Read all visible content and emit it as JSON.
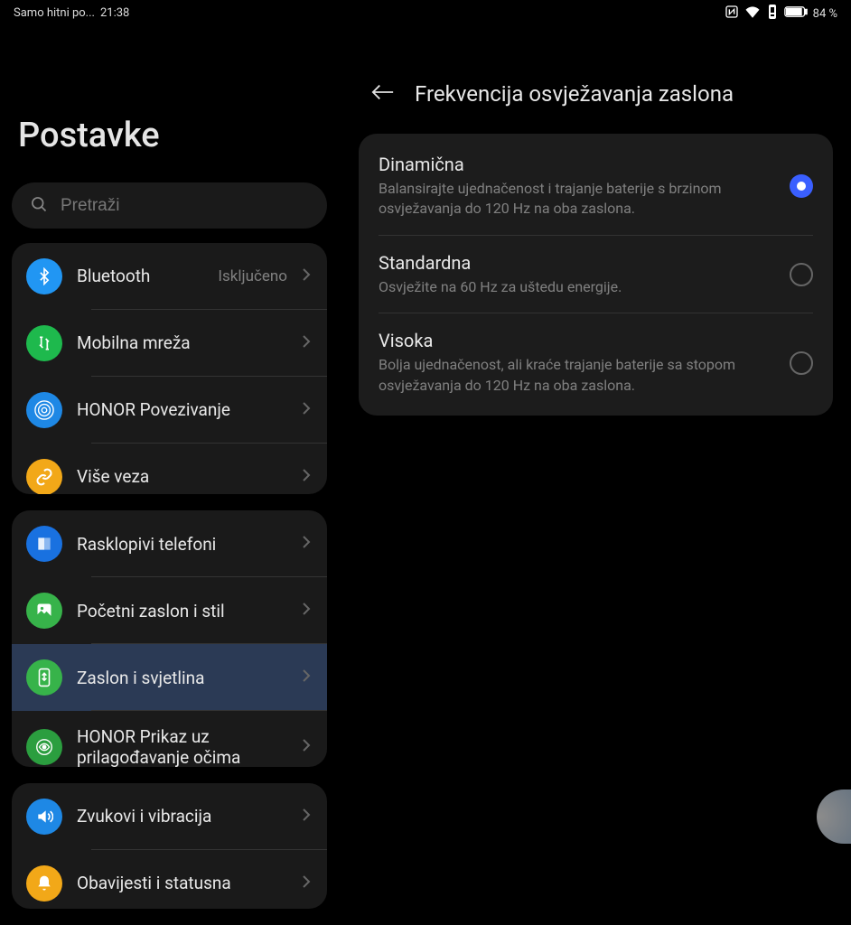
{
  "statusBar": {
    "leftText": "Samo hitni po...",
    "time": "21:38",
    "battery": "84 %"
  },
  "leftPanel": {
    "title": "Postavke",
    "searchPlaceholder": "Pretraži",
    "groups": [
      {
        "items": [
          {
            "icon": "bluetooth",
            "label": "Bluetooth",
            "status": "Isključeno"
          },
          {
            "icon": "mobile",
            "label": "Mobilna mreža",
            "status": ""
          },
          {
            "icon": "honor",
            "label": "HONOR Povezivanje",
            "status": ""
          },
          {
            "icon": "more",
            "label": "Više veza",
            "status": ""
          }
        ]
      },
      {
        "items": [
          {
            "icon": "foldable",
            "label": "Rasklopivi telefoni",
            "status": ""
          },
          {
            "icon": "home",
            "label": "Početni zaslon i stil",
            "status": ""
          },
          {
            "icon": "display",
            "label": "Zaslon i svjetlina",
            "status": "",
            "active": true
          },
          {
            "icon": "eyes",
            "label": "HONOR Prikaz uz prilagođavanje očima",
            "status": ""
          }
        ]
      },
      {
        "items": [
          {
            "icon": "sound",
            "label": "Zvukovi i vibracija",
            "status": ""
          },
          {
            "icon": "notif",
            "label": "Obavijesti i statusna",
            "status": ""
          }
        ]
      }
    ]
  },
  "rightPanel": {
    "title": "Frekvencija osvježavanja zaslona",
    "options": [
      {
        "title": "Dinamična",
        "desc": "Balansirajte ujednačenost i trajanje baterije s brzinom osvježavanja do 120 Hz na oba zaslona.",
        "selected": true
      },
      {
        "title": "Standardna",
        "desc": "Osvježite na 60 Hz za uštedu energije.",
        "selected": false
      },
      {
        "title": "Visoka",
        "desc": "Bolja ujednačenost, ali kraće trajanje baterije sa stopom osvježavanja do 120 Hz na oba zaslona.",
        "selected": false
      }
    ]
  }
}
